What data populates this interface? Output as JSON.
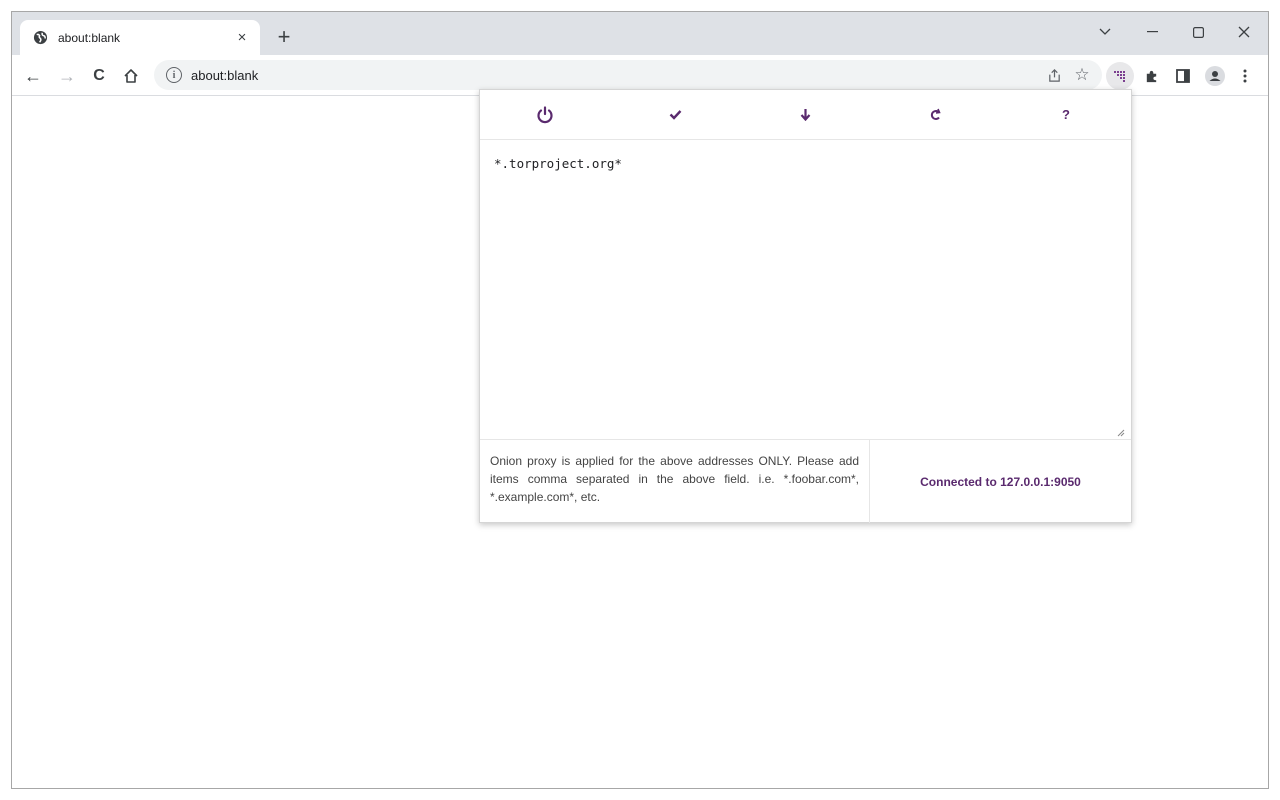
{
  "browser": {
    "tab": {
      "title": "about:blank",
      "favicon": "globe-icon",
      "close": "×"
    },
    "new_tab": "+",
    "window_controls": {
      "tab_search": "∨",
      "minimize": "–",
      "maximize": "☐",
      "close": "✕"
    },
    "toolbar": {
      "back": "←",
      "forward": "→",
      "reload": "C",
      "home": "home-icon",
      "url": "about:blank",
      "share": "share-icon",
      "bookmark": "☆"
    }
  },
  "popup": {
    "toolbar": [
      {
        "name": "power",
        "glyph": "⏻"
      },
      {
        "name": "apply",
        "glyph": "✔"
      },
      {
        "name": "download",
        "glyph": "🡓"
      },
      {
        "name": "reload",
        "glyph": "¢"
      },
      {
        "name": "help",
        "glyph": "?"
      }
    ],
    "addresses": "*.torproject.org*",
    "note": "Onion proxy is applied for the above addresses ONLY. Please add items comma separated in the above field. i.e. *.foobar.com*, *.example.com*, etc.",
    "status": "Connected to 127.0.0.1:9050"
  },
  "colors": {
    "accent": "#5a2a6e",
    "tabstrip": "#dee1e6",
    "omnibox": "#f1f3f4"
  }
}
